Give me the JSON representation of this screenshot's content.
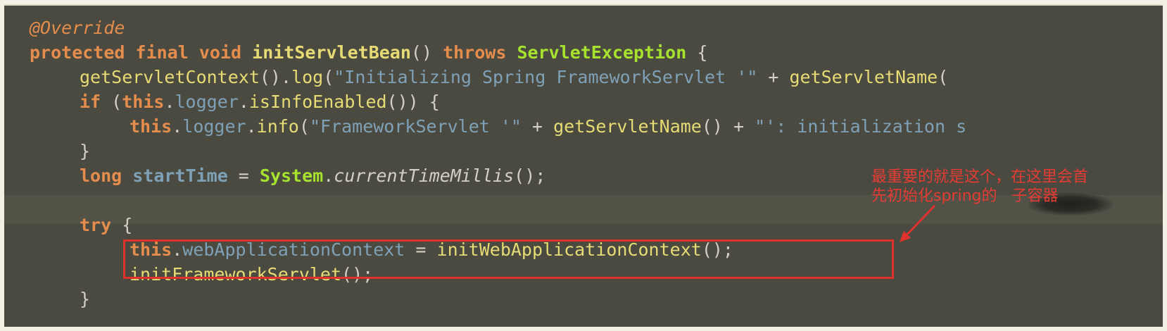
{
  "code": {
    "lines": [
      {
        "tokens": [
          {
            "t": "@Override",
            "c": "ann"
          }
        ]
      },
      {
        "tokens": [
          {
            "t": "protected",
            "c": "kw"
          },
          {
            "t": " ",
            "c": "punc"
          },
          {
            "t": "final",
            "c": "kw"
          },
          {
            "t": " ",
            "c": "punc"
          },
          {
            "t": "void",
            "c": "kw"
          },
          {
            "t": " ",
            "c": "punc"
          },
          {
            "t": "initServletBean",
            "c": "method kw"
          },
          {
            "t": "() ",
            "c": "punc"
          },
          {
            "t": "throws",
            "c": "kw"
          },
          {
            "t": " ",
            "c": "punc"
          },
          {
            "t": "ServletException",
            "c": "type"
          },
          {
            "t": " {",
            "c": "punc"
          }
        ]
      },
      {
        "tokens": [
          {
            "t": "getServletContext",
            "c": "method"
          },
          {
            "t": "().",
            "c": "punc"
          },
          {
            "t": "log",
            "c": "method"
          },
          {
            "t": "(",
            "c": "punc"
          },
          {
            "t": "\"Initializing Spring FrameworkServlet '\"",
            "c": "string"
          },
          {
            "t": " + ",
            "c": "punc"
          },
          {
            "t": "getServletName",
            "c": "method"
          },
          {
            "t": "(",
            "c": "punc"
          }
        ]
      },
      {
        "tokens": [
          {
            "t": "if",
            "c": "kw"
          },
          {
            "t": " (",
            "c": "punc"
          },
          {
            "t": "this",
            "c": "kw"
          },
          {
            "t": ".",
            "c": "punc"
          },
          {
            "t": "logger",
            "c": "field"
          },
          {
            "t": ".",
            "c": "punc"
          },
          {
            "t": "isInfoEnabled",
            "c": "method"
          },
          {
            "t": "()) {",
            "c": "punc"
          }
        ]
      },
      {
        "tokens": [
          {
            "t": "this",
            "c": "kw"
          },
          {
            "t": ".",
            "c": "punc"
          },
          {
            "t": "logger",
            "c": "field"
          },
          {
            "t": ".",
            "c": "punc"
          },
          {
            "t": "info",
            "c": "method"
          },
          {
            "t": "(",
            "c": "punc"
          },
          {
            "t": "\"FrameworkServlet '\"",
            "c": "string"
          },
          {
            "t": " + ",
            "c": "punc"
          },
          {
            "t": "getServletName",
            "c": "method"
          },
          {
            "t": "() + ",
            "c": "punc"
          },
          {
            "t": "\"': initialization s",
            "c": "string"
          }
        ]
      },
      {
        "tokens": [
          {
            "t": "}",
            "c": "punc"
          }
        ]
      },
      {
        "tokens": [
          {
            "t": "long",
            "c": "kw"
          },
          {
            "t": " ",
            "c": "punc"
          },
          {
            "t": "startTime",
            "c": "var"
          },
          {
            "t": " = ",
            "c": "punc"
          },
          {
            "t": "System",
            "c": "type"
          },
          {
            "t": ".",
            "c": "punc"
          },
          {
            "t": "currentTimeMillis",
            "c": "italic"
          },
          {
            "t": "();",
            "c": "punc"
          }
        ]
      },
      {
        "tokens": []
      },
      {
        "tokens": [
          {
            "t": "try",
            "c": "kw"
          },
          {
            "t": " {",
            "c": "punc"
          }
        ]
      },
      {
        "tokens": [
          {
            "t": "this",
            "c": "kw"
          },
          {
            "t": ".",
            "c": "punc"
          },
          {
            "t": "webApplicationContext",
            "c": "field"
          },
          {
            "t": " = ",
            "c": "punc"
          },
          {
            "t": "initWebApplicationContext",
            "c": "method"
          },
          {
            "t": "();",
            "c": "punc"
          }
        ]
      },
      {
        "tokens": [
          {
            "t": "initFrameworkServlet",
            "c": "method"
          },
          {
            "t": "();",
            "c": "punc"
          }
        ]
      },
      {
        "tokens": [
          {
            "t": "}",
            "c": "punc"
          }
        ]
      }
    ]
  },
  "annotation": {
    "line1": "最重要的就是这个，在这里会首",
    "line2": "先初始化spring的",
    "line2_covered": "子容器",
    "color": "#e0322d"
  }
}
